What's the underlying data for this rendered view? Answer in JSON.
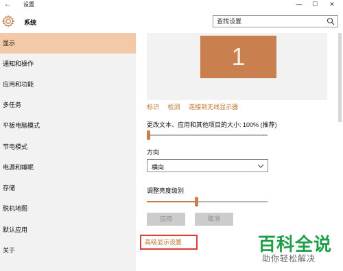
{
  "window": {
    "title": "设置",
    "back_icon": "←",
    "minimize_icon": "—",
    "maximize_icon": "☐",
    "close_icon": "✕"
  },
  "header": {
    "app_name": "系统",
    "search_placeholder": "查找设置",
    "accent": "#c97f4e"
  },
  "sidebar": {
    "items": [
      {
        "label": "显示",
        "selected": true
      },
      {
        "label": "通知和操作"
      },
      {
        "label": "应用和功能"
      },
      {
        "label": "多任务"
      },
      {
        "label": "平板电脑模式"
      },
      {
        "label": "节电模式"
      },
      {
        "label": "电源和睡眠"
      },
      {
        "label": "存储"
      },
      {
        "label": "脱机地图"
      },
      {
        "label": "默认应用"
      },
      {
        "label": "关于"
      }
    ]
  },
  "main": {
    "monitor_number": "1",
    "links": [
      "标识",
      "检测",
      "连接到无线显示器"
    ],
    "scale_label": "更改文本、应用和其他项目的大小: 100% (推荐)",
    "scale_slider_fraction": 0.0,
    "orientation_label": "方向",
    "orientation_value": "横向",
    "brightness_label": "调整亮度级别",
    "brightness_fraction": 0.41,
    "apply_button": "应用",
    "cancel_button": "取消",
    "advanced_link": "高级显示设置"
  },
  "watermark": {
    "title": "百科全说",
    "subtitle": "助你轻松解决"
  }
}
